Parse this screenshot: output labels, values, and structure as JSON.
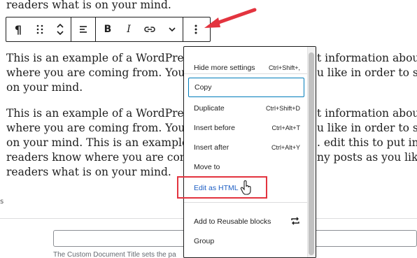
{
  "editor": {
    "line_top": "readers what is on your mind.",
    "paragraph_1": [
      "This is an example of a WordPress po",
      "where you are coming from. You can",
      "on your mind."
    ],
    "paragraph_1_right": [
      "t information about y",
      "u like in order to sha"
    ],
    "paragraph_2": [
      "This is an example of a WordPress po",
      "where you are coming from. You can",
      "on your mind. This is an example of",
      "readers know where you are coming",
      "readers what is on your mind."
    ],
    "paragraph_2_right": [
      "t information about y",
      "u like in order to shar",
      ". edit this to put info",
      "ny posts as you like i"
    ],
    "edge_letter": "s"
  },
  "toolbar": {
    "buttons": [
      {
        "name": "paragraph-icon",
        "glyph": "¶"
      },
      {
        "name": "drag-handle-icon"
      },
      {
        "name": "move-up-down-icon"
      },
      {
        "name": "align-icon"
      },
      {
        "name": "bold-button",
        "glyph": "B"
      },
      {
        "name": "italic-button",
        "glyph": "I"
      },
      {
        "name": "link-icon"
      },
      {
        "name": "more-formats-chevron-icon"
      },
      {
        "name": "options-kebab-icon"
      }
    ]
  },
  "menu": {
    "hide_more_settings": {
      "label": "Hide more settings",
      "shortcut": "Ctrl+Shift+,"
    },
    "copy": {
      "label": "Copy"
    },
    "duplicate": {
      "label": "Duplicate",
      "shortcut": "Ctrl+Shift+D"
    },
    "insert_before": {
      "label": "Insert before",
      "shortcut": "Ctrl+Alt+T"
    },
    "insert_after": {
      "label": "Insert after",
      "shortcut": "Ctrl+Alt+Y"
    },
    "move_to": {
      "label": "Move to"
    },
    "edit_as_html": {
      "label": "Edit as HTML"
    },
    "add_to_reusable": {
      "label": "Add to Reusable blocks",
      "icon": "reusable-block-icon"
    },
    "group": {
      "label": "Group"
    }
  },
  "meta": {
    "help_text": "The Custom Document Title sets the pa"
  },
  "colors": {
    "accent": "#007cba",
    "highlight_box": "#e3343f",
    "link_text": "#1e5fc4"
  }
}
